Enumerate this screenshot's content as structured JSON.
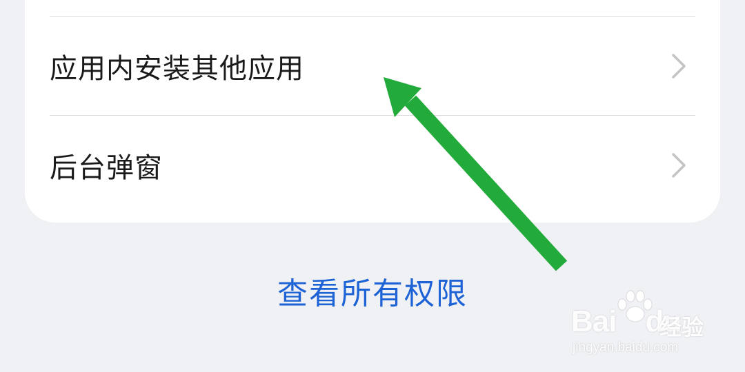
{
  "settings_list": {
    "items": [
      {
        "label": "应用内安装其他应用"
      },
      {
        "label": "后台弹窗"
      }
    ]
  },
  "view_all_link": {
    "label": "查看所有权限"
  },
  "watermark": {
    "brand": "Bai",
    "brand_suffix": "du",
    "product": "经验",
    "url": "jingyan.baidu.com"
  },
  "colors": {
    "background": "#f0f1f5",
    "card": "#ffffff",
    "link": "#1d63d6",
    "annotation_arrow": "#22aa3a",
    "chevron": "#c4c4c4"
  }
}
